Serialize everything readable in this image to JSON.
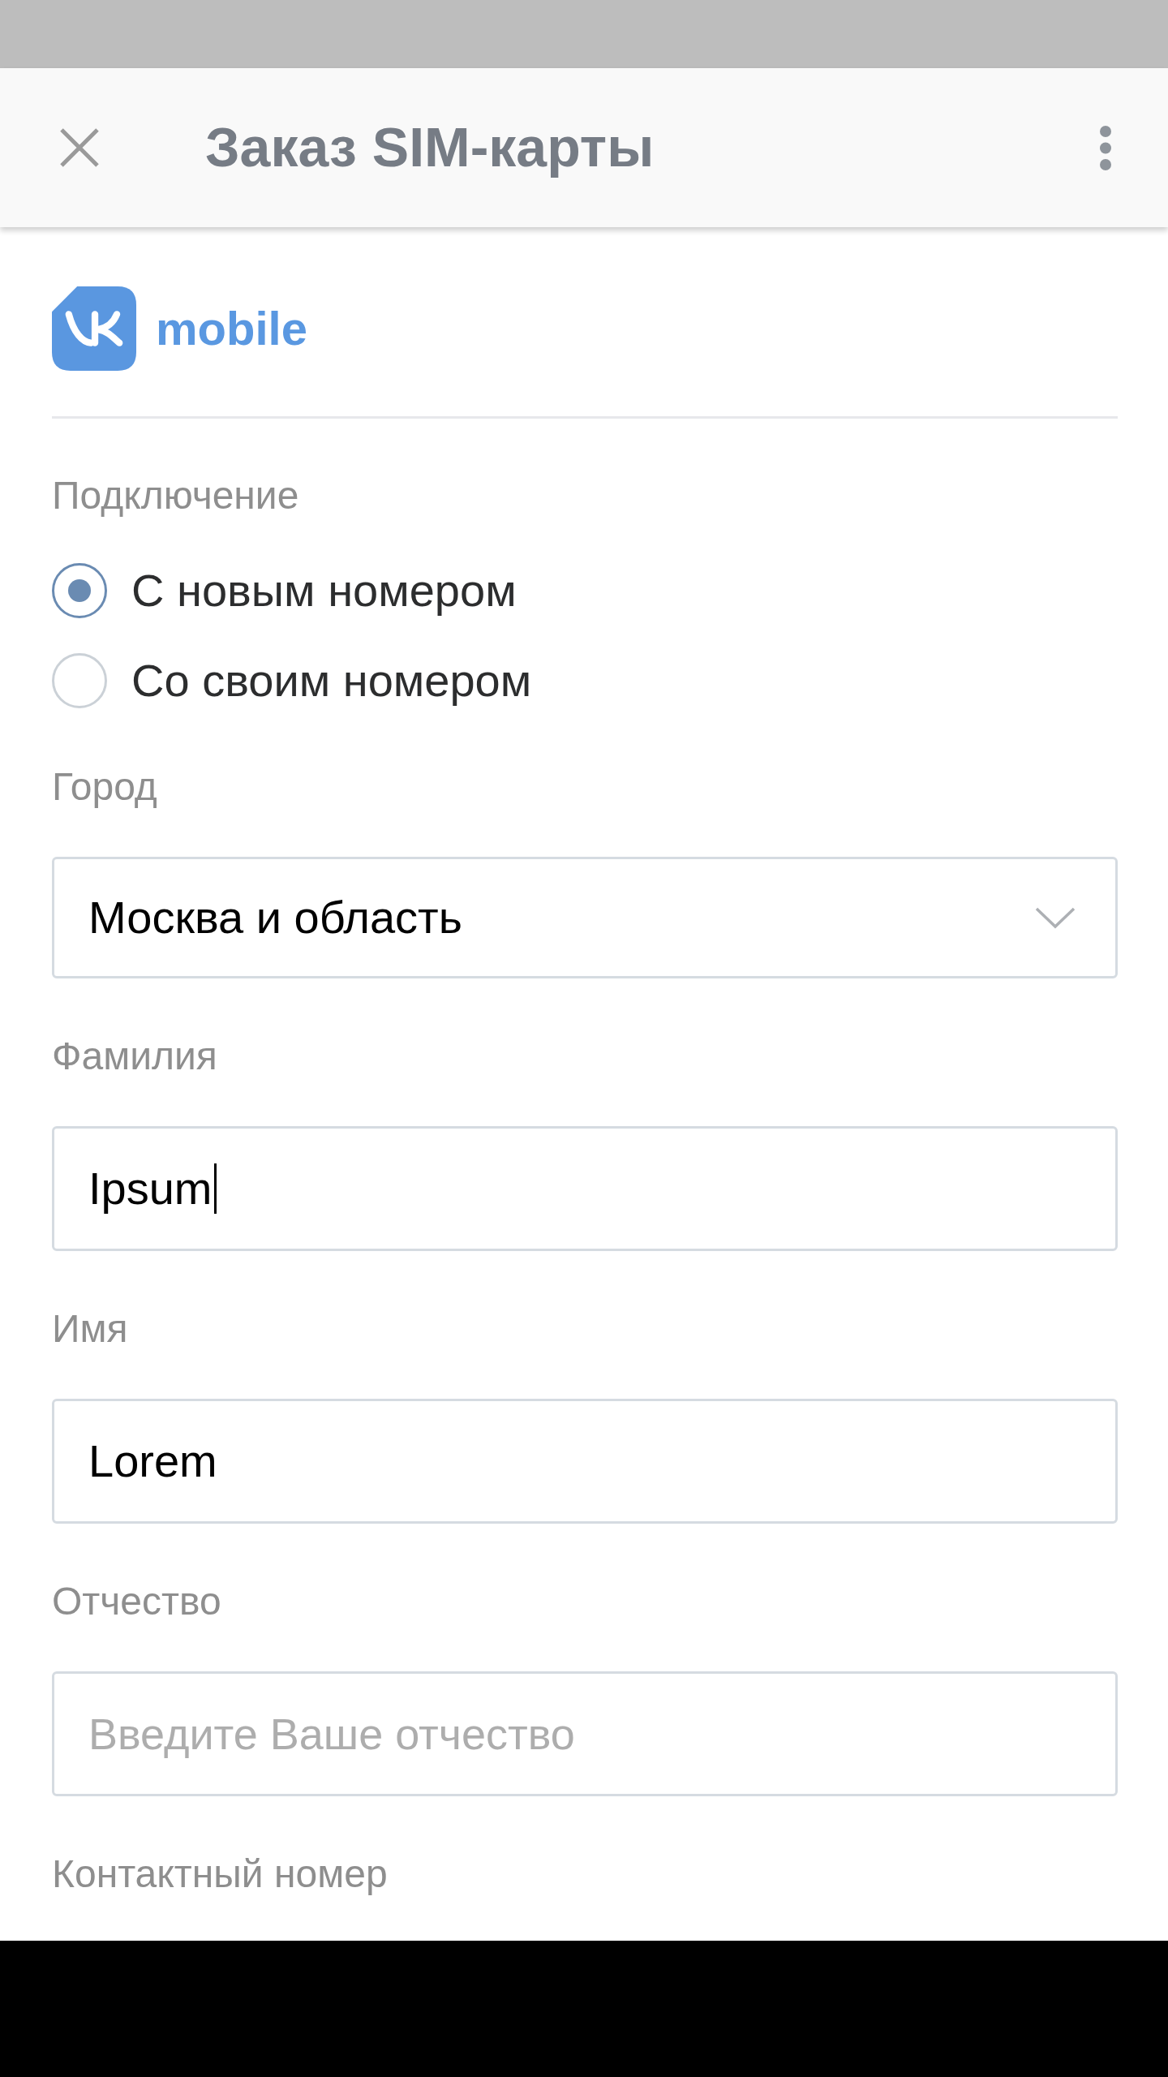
{
  "app_bar": {
    "title": "Заказ SIM-карты"
  },
  "logo": {
    "text": "mobile"
  },
  "connection": {
    "label": "Подключение",
    "options": [
      {
        "label": "С новым номером",
        "selected": true
      },
      {
        "label": "Со своим номером",
        "selected": false
      }
    ]
  },
  "fields": [
    {
      "label": "Город",
      "control": {
        "kind": "select",
        "value": "Москва и область"
      }
    },
    {
      "label": "Фамилия",
      "control": {
        "kind": "text",
        "value": "Ipsum",
        "focused": true
      }
    },
    {
      "label": "Имя",
      "control": {
        "kind": "text",
        "value": "Lorem",
        "focused": false
      }
    },
    {
      "label": "Отчество",
      "control": {
        "kind": "text",
        "placeholder": "Введите Ваше отчество",
        "focused": false
      }
    },
    {
      "label": "Контактный номер"
    }
  ]
}
